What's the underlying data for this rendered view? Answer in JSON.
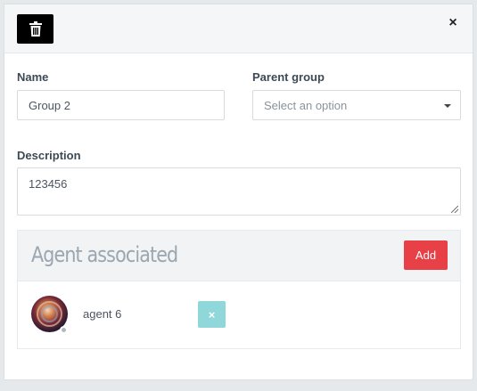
{
  "header": {
    "delete_icon": "trash-icon",
    "close_label": "×"
  },
  "form": {
    "name_label": "Name",
    "name_value": "Group 2",
    "parent_label": "Parent group",
    "parent_placeholder": "Select an option",
    "description_label": "Description",
    "description_value": "123456"
  },
  "agents": {
    "title": "Agent associated",
    "add_label": "Add",
    "items": [
      {
        "name": "agent 6",
        "remove_label": "×",
        "status": "offline"
      }
    ]
  },
  "colors": {
    "add_button": "#e84047",
    "remove_button": "#8fd7d9",
    "header_bg": "#f5f6f7"
  }
}
